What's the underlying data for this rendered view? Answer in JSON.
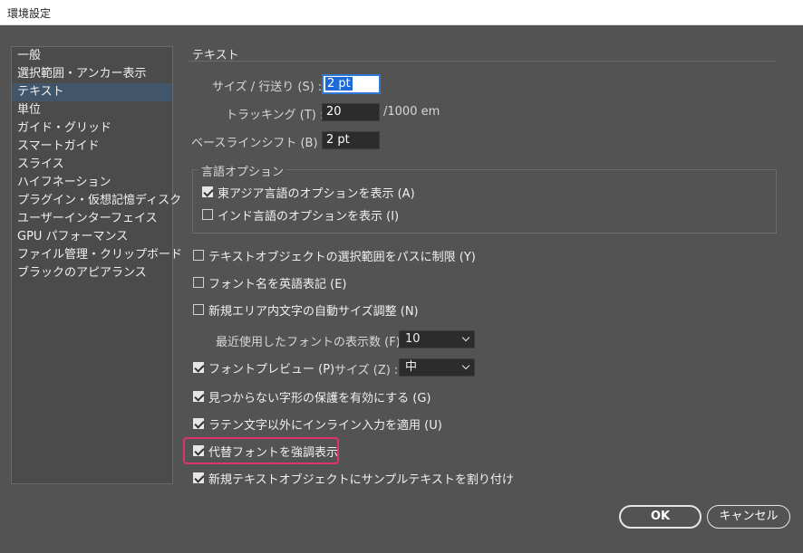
{
  "window": {
    "title": "環境設定"
  },
  "sidebar": {
    "items": [
      {
        "label": "一般"
      },
      {
        "label": "選択範囲・アンカー表示"
      },
      {
        "label": "テキスト",
        "selected": true
      },
      {
        "label": "単位"
      },
      {
        "label": "ガイド・グリッド"
      },
      {
        "label": "スマートガイド"
      },
      {
        "label": "スライス"
      },
      {
        "label": "ハイフネーション"
      },
      {
        "label": "プラグイン・仮想記憶ディスク"
      },
      {
        "label": "ユーザーインターフェイス"
      },
      {
        "label": "GPU パフォーマンス"
      },
      {
        "label": "ファイル管理・クリップボード"
      },
      {
        "label": "ブラックのアピアランス"
      }
    ]
  },
  "main": {
    "section_title": "テキスト",
    "size_leading": {
      "label": "サイズ / 行送り (S) :",
      "value": "2 pt"
    },
    "tracking": {
      "label": "トラッキング (T) :",
      "value": "20",
      "unit": "/1000 em"
    },
    "baseline_shift": {
      "label": "ベースラインシフト (B) :",
      "value": "2 pt"
    },
    "language_options": {
      "title": "言語オプション",
      "east_asian": {
        "label": "東アジア言語のオプションを表示 (A)",
        "checked": true
      },
      "indic": {
        "label": "インド言語のオプションを表示 (I)",
        "checked": false
      }
    },
    "options": {
      "limit_selection": {
        "label": "テキストオブジェクトの選択範囲をパスに制限 (Y)",
        "checked": false
      },
      "english_font_names": {
        "label": "フォント名を英語表記 (E)",
        "checked": false
      },
      "auto_size_area": {
        "label": "新規エリア内文字の自動サイズ調整 (N)",
        "checked": false
      },
      "recent_fonts": {
        "label": "最近使用したフォントの表示数 (F) :",
        "value": "10"
      },
      "font_preview": {
        "label": "フォントプレビュー (P)",
        "checked": true,
        "size_label": "サイズ (Z) :",
        "size_value": "中"
      },
      "missing_glyph": {
        "label": "見つからない字形の保護を有効にする (G)",
        "checked": true
      },
      "inline_input": {
        "label": "ラテン文字以外にインライン入力を適用 (U)",
        "checked": true
      },
      "highlight_substituted": {
        "label": "代替フォントを強調表示",
        "checked": true
      },
      "fill_placeholder": {
        "label": "新規テキストオブジェクトにサンプルテキストを割り付け",
        "checked": true
      }
    }
  },
  "buttons": {
    "ok": "OK",
    "cancel": "キャンセル"
  },
  "colors": {
    "background": "#535353",
    "selected_item": "#42566b",
    "highlight_border": "#e0336c",
    "input_focus": "#1e6ad9"
  }
}
